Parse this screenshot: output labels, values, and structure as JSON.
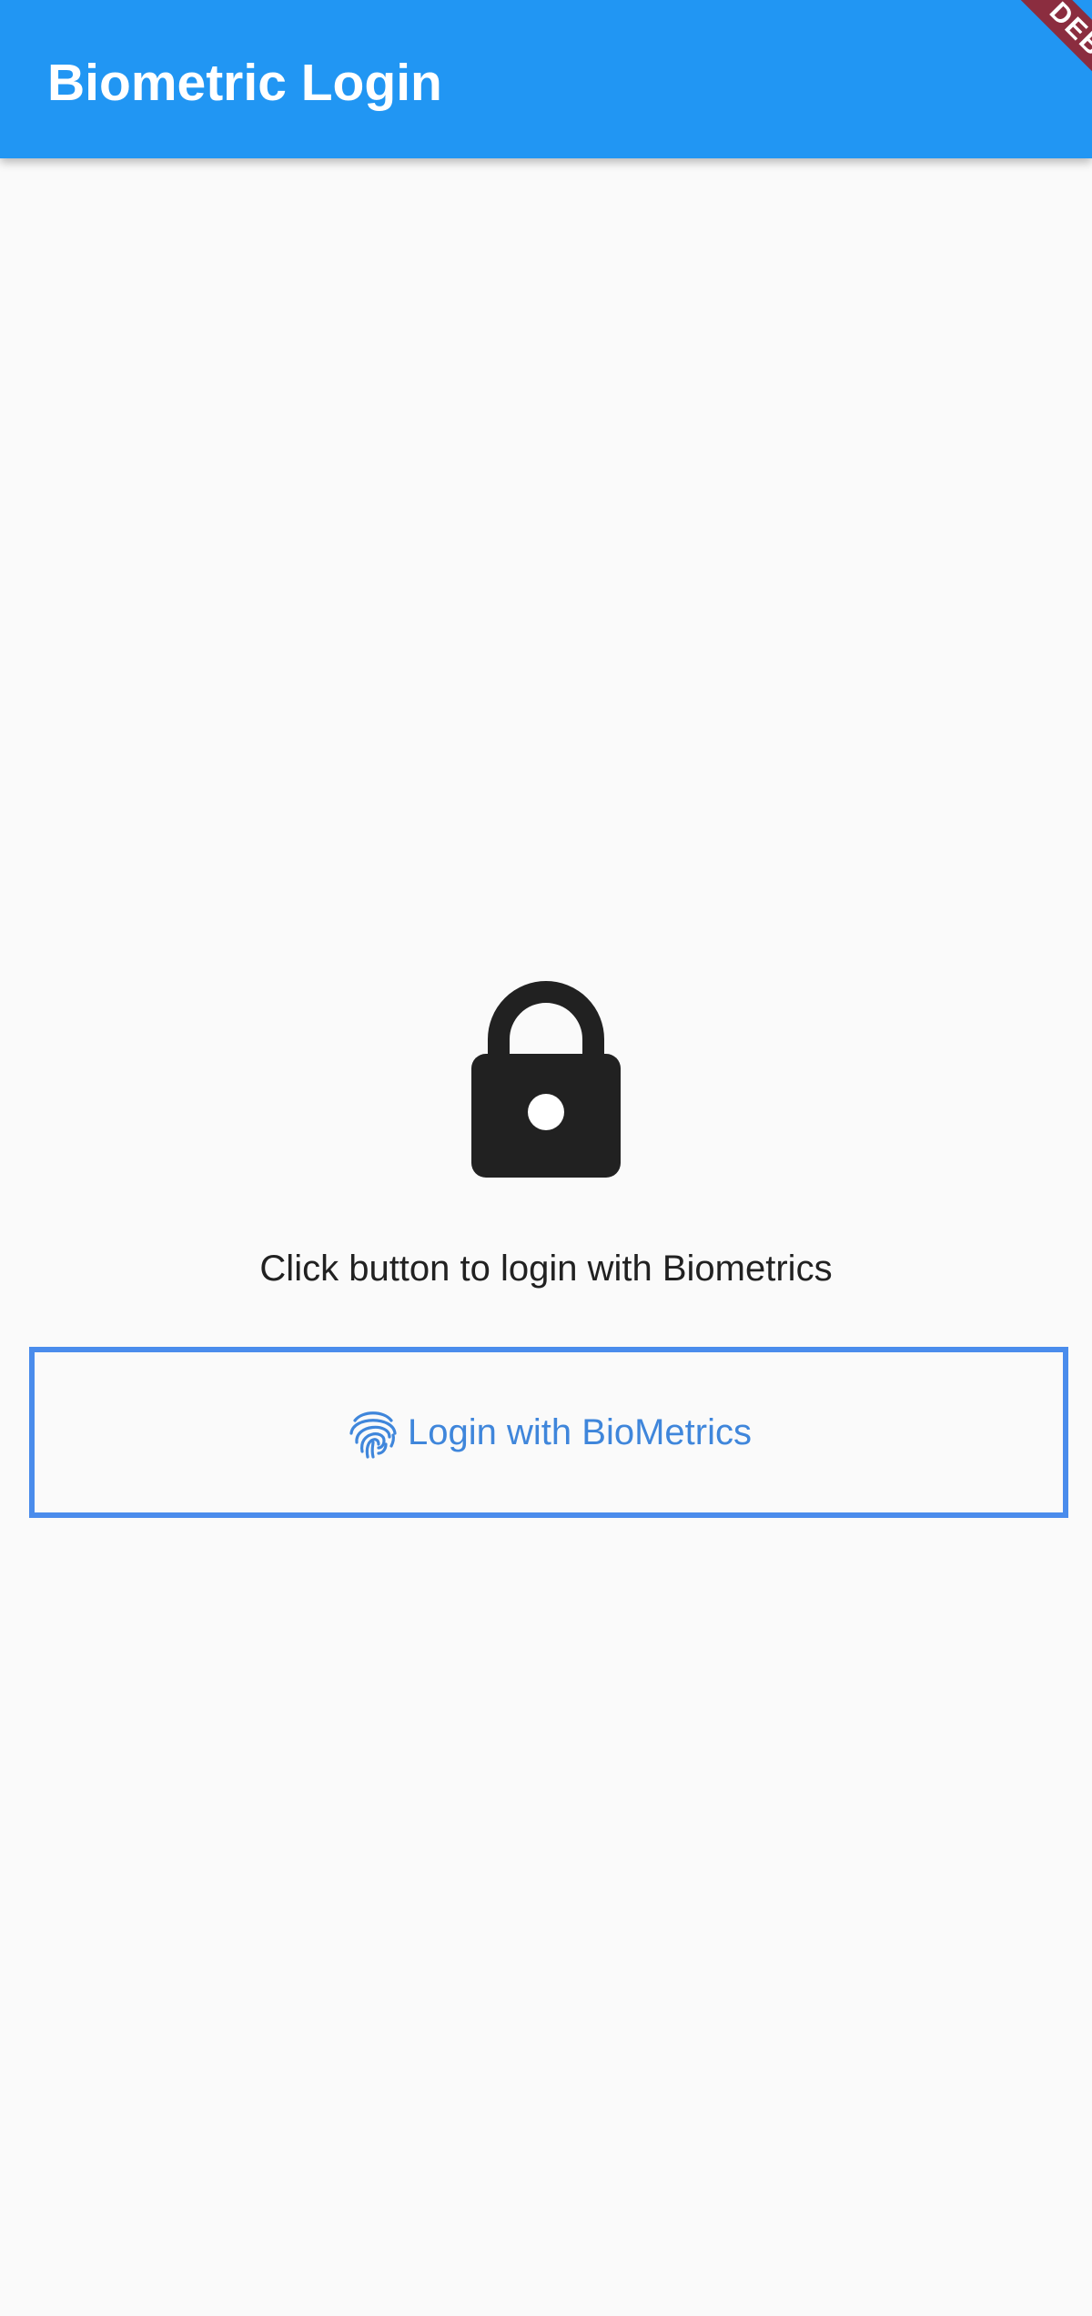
{
  "app_bar": {
    "title": "Biometric Login",
    "background": "#2196f3"
  },
  "debug_banner": {
    "label": "DEBUG",
    "color": "#8b2d3f"
  },
  "main": {
    "icon": "lock-icon",
    "hint": "Click button to login with Biometrics",
    "login_button": {
      "icon": "fingerprint-icon",
      "label": "Login with BioMetrics",
      "color": "#3f86db"
    }
  }
}
